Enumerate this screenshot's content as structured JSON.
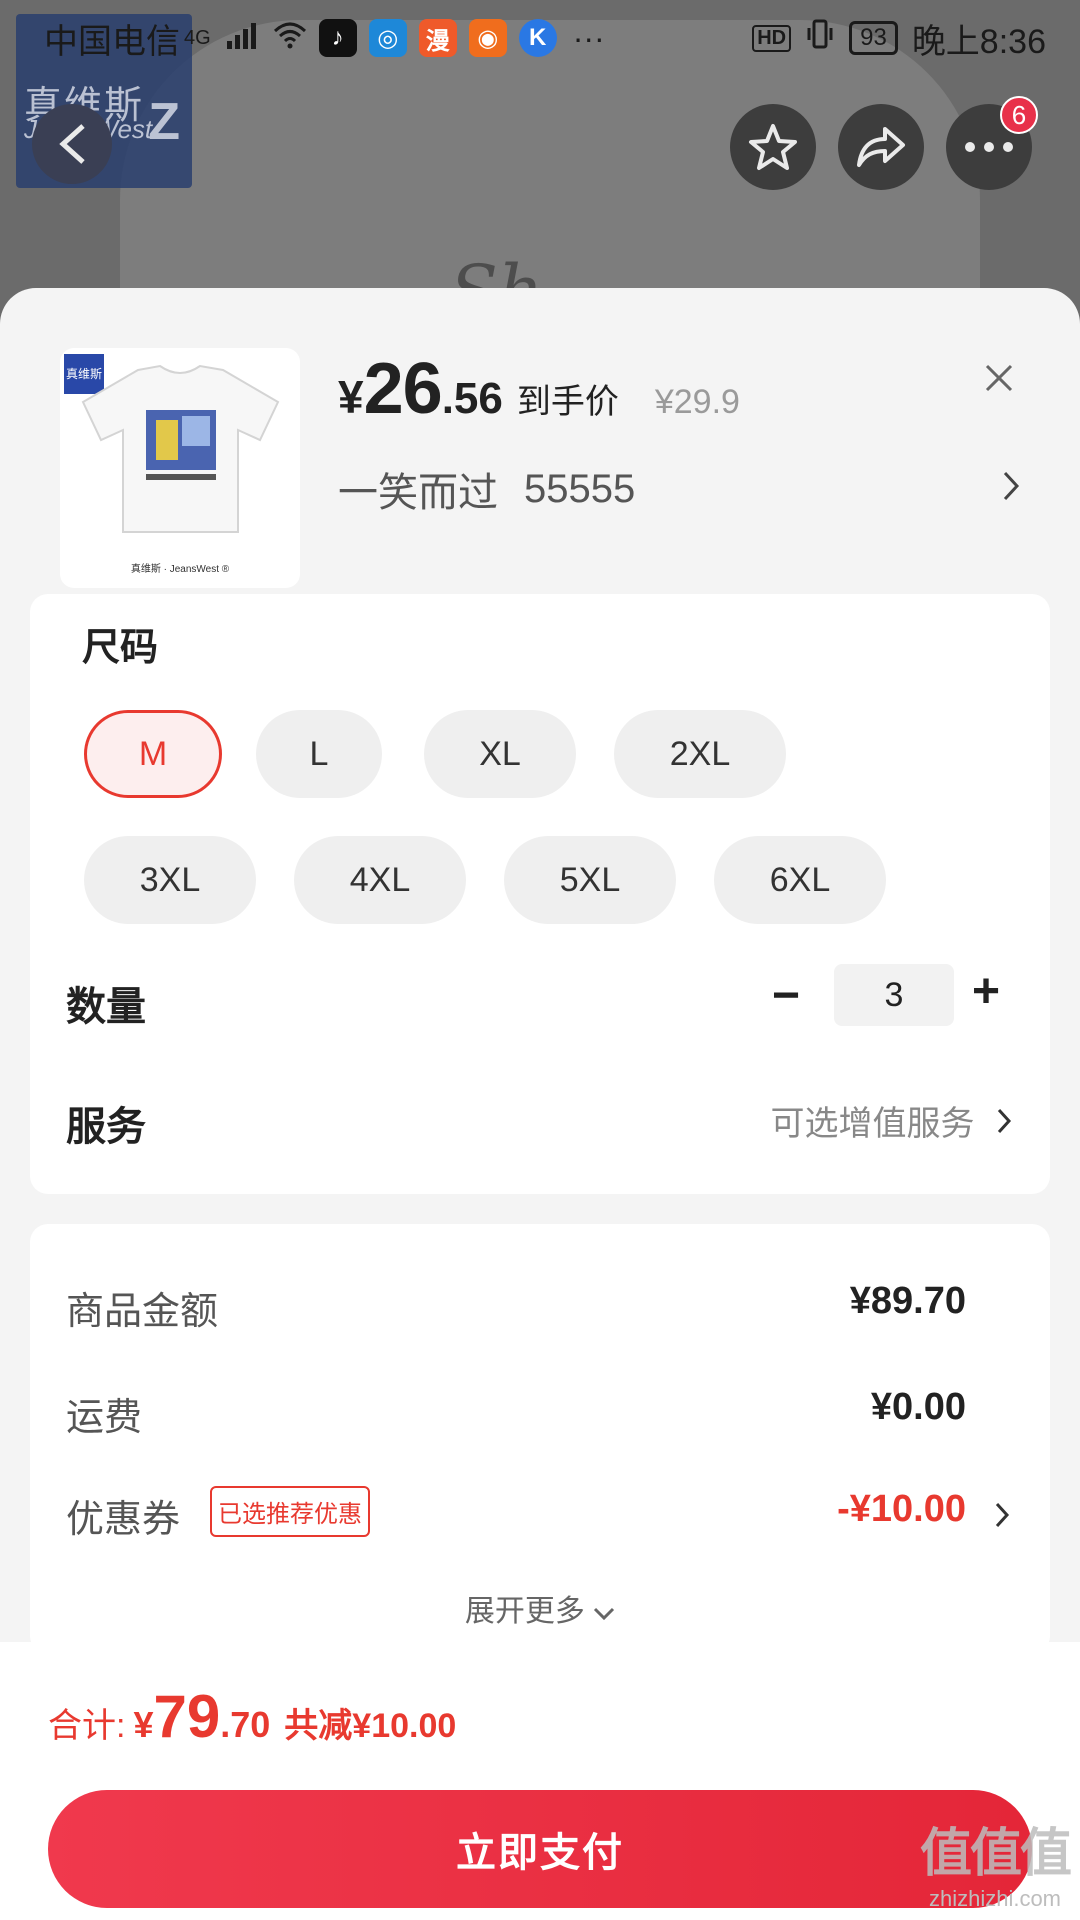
{
  "status_bar": {
    "carrier": "中国电信",
    "network": "4G",
    "dots": "···",
    "hd": "HD",
    "battery": "93",
    "time": "晚上8:36"
  },
  "brand": {
    "cn": "真维斯",
    "en": "JeansWest",
    "mark": "Z"
  },
  "background_script": "Sh",
  "nav": {
    "more_badge": "6"
  },
  "product": {
    "thumb_logo": "真维斯",
    "thumb_caption": "真维斯 · JeansWest ®",
    "price_symbol": "¥",
    "price_int": "26",
    "price_dec": ".56",
    "price_tag": "到手价",
    "original_price": "¥29.9",
    "spec_name": "一笑而过",
    "spec_value": "55555"
  },
  "size": {
    "title": "尺码",
    "options": [
      "M",
      "L",
      "XL",
      "2XL",
      "3XL",
      "4XL",
      "5XL",
      "6XL"
    ],
    "selected": "M"
  },
  "quantity": {
    "label": "数量",
    "value": "3",
    "minus": "−",
    "plus": "+"
  },
  "service": {
    "label": "服务",
    "value": "可选增值服务"
  },
  "summary": {
    "goods_label": "商品金额",
    "goods_value": "¥89.70",
    "shipping_label": "运费",
    "shipping_value": "¥0.00",
    "coupon_label": "优惠券",
    "coupon_tag": "已选推荐优惠",
    "coupon_value": "-¥10.00",
    "expand": "展开更多"
  },
  "footer": {
    "total_label": "合计:",
    "total_symbol": "¥",
    "total_int": "79",
    "total_dec": ".70",
    "saved": "共减¥10.00",
    "pay_button": "立即支付"
  },
  "watermark": {
    "big": "值值值",
    "small": "zhizhizhi.com"
  },
  "colors": {
    "accent": "#e8392f",
    "pay_button": "#ef3447",
    "sheet_bg": "#f4f4f4"
  }
}
